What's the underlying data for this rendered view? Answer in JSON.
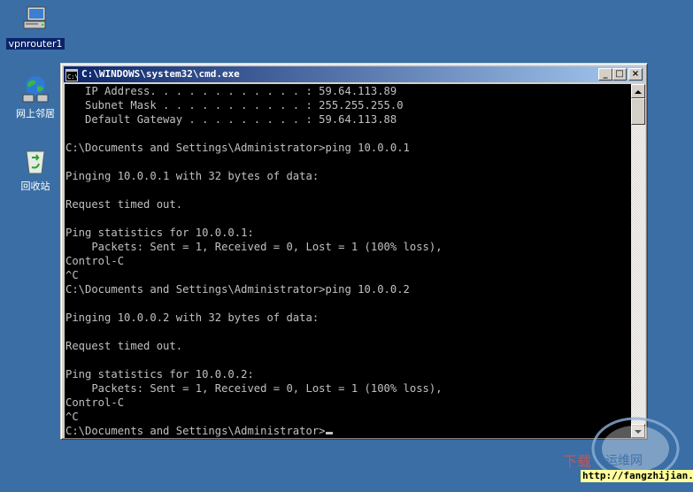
{
  "desktop": {
    "background_color": "#3a6ea5",
    "icons": [
      {
        "label": "vpnrouter1",
        "icon": "computer-icon"
      },
      {
        "label": "网上邻居",
        "icon": "network-places-icon"
      },
      {
        "label": "回收站",
        "icon": "recycle-bin-icon"
      }
    ]
  },
  "window": {
    "title": "C:\\WINDOWS\\system32\\cmd.exe",
    "icon": "cmd-icon",
    "buttons": {
      "minimize": "_",
      "maximize": "□",
      "close": "×"
    }
  },
  "console": {
    "lines": [
      "   IP Address. . . . . . . . . . . . : 59.64.113.89",
      "   Subnet Mask . . . . . . . . . . . : 255.255.255.0",
      "   Default Gateway . . . . . . . . . : 59.64.113.88",
      "",
      "C:\\Documents and Settings\\Administrator>ping 10.0.0.1",
      "",
      "Pinging 10.0.0.1 with 32 bytes of data:",
      "",
      "Request timed out.",
      "",
      "Ping statistics for 10.0.0.1:",
      "    Packets: Sent = 1, Received = 0, Lost = 1 (100% loss),",
      "Control-C",
      "^C",
      "C:\\Documents and Settings\\Administrator>ping 10.0.0.2",
      "",
      "Pinging 10.0.0.2 with 32 bytes of data:",
      "",
      "Request timed out.",
      "",
      "Ping statistics for 10.0.0.2:",
      "    Packets: Sent = 1, Received = 0, Lost = 1 (100% loss),",
      "Control-C",
      "^C"
    ],
    "prompt": "C:\\Documents and Settings\\Administrator>",
    "text_color": "#c0c0c0",
    "background": "#000000"
  },
  "watermark": {
    "text": "http://fangzhijian.net",
    "logo_text": "下载 运维网",
    "logo_url": "iyunv.com"
  }
}
